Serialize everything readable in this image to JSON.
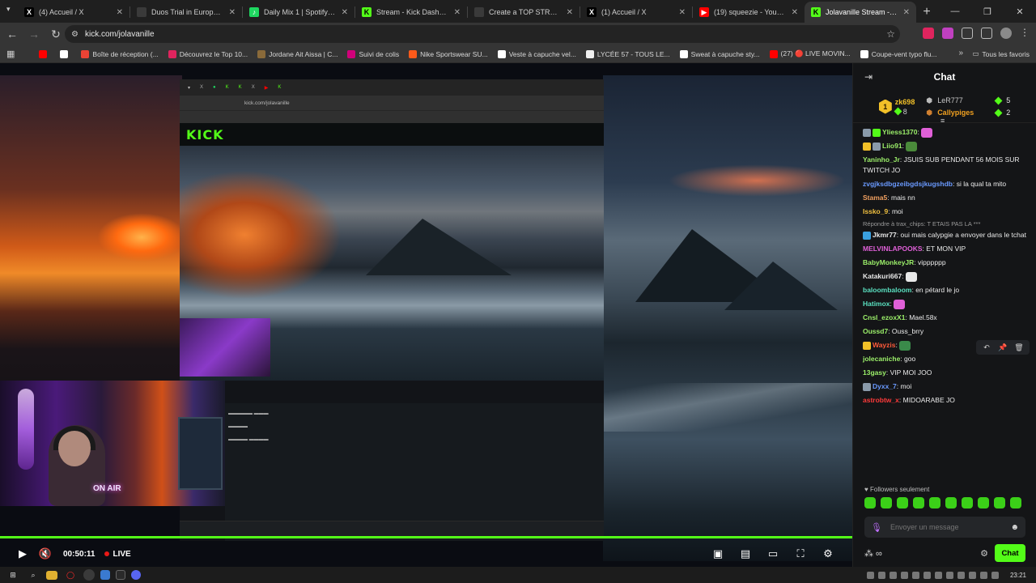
{
  "browser": {
    "tabs": [
      {
        "label": "(4) Accueil / X",
        "icon": "x-logo-icon",
        "icon_text": "X",
        "icon_color": "#000000",
        "active": false
      },
      {
        "label": "Duos Trial in Europe: Sessi",
        "icon": "page-icon",
        "icon_text": "",
        "icon_color": "#3a3a3a",
        "active": false
      },
      {
        "label": "Daily Mix 1 | Spotify Playli",
        "icon": "spotify-icon",
        "icon_text": "♪",
        "icon_color": "#1ed760",
        "active": false
      },
      {
        "label": "Stream - Kick Dashboard",
        "icon": "kick-icon",
        "icon_text": "K",
        "icon_color": "#53fc18",
        "active": false
      },
      {
        "label": "Create a TOP STREAMER",
        "icon": "page-icon",
        "icon_text": "",
        "icon_color": "#3a3a3a",
        "active": false
      },
      {
        "label": "(1) Accueil / X",
        "icon": "x-logo-icon",
        "icon_text": "X",
        "icon_color": "#000000",
        "active": false
      },
      {
        "label": "(19) squeezie - YouTube",
        "icon": "youtube-icon",
        "icon_text": "▶",
        "icon_color": "#ff0000",
        "active": false
      },
      {
        "label": "Jolavanille Stream - Watc",
        "icon": "kick-icon",
        "icon_text": "K",
        "icon_color": "#53fc18",
        "active": true
      }
    ],
    "url": "kick.com/jolavanille",
    "bookmarks": [
      {
        "label": "",
        "color": "#ff0000"
      },
      {
        "label": "",
        "color": "#ffffff"
      },
      {
        "label": "Boîte de réception (...",
        "color": "#ea4335"
      },
      {
        "label": "Découvrez le Top 10...",
        "color": "#e0245e"
      },
      {
        "label": "Jordane Ait Aissa | C...",
        "color": "#8a6a3a"
      },
      {
        "label": "Suivi de colis",
        "color": "#d0007a"
      },
      {
        "label": "Nike Sportswear SU...",
        "color": "#ff5a1a"
      },
      {
        "label": "Veste à capuche vel...",
        "color": "#ffffff"
      },
      {
        "label": "LYCÉE 57 - TOUS LE...",
        "color": "#f0f0f0"
      },
      {
        "label": "Sweat à capuche sty...",
        "color": "#ffffff"
      },
      {
        "label": "(27) 🔴 LIVE MOVIN...",
        "color": "#ff0000"
      },
      {
        "label": "Coupe-vent typo flu...",
        "color": "#ffffff"
      }
    ],
    "all_bookmarks": "Tous les favoris"
  },
  "player": {
    "inner_logo": "KICK",
    "time": "00:50:11",
    "live": "LIVE",
    "on_air": "ON AIR"
  },
  "chat": {
    "title": "Chat",
    "leaderboard": {
      "top": {
        "name": "zk698",
        "rank": "1",
        "points": "8"
      },
      "others": [
        {
          "name": "LeR777",
          "points": "5"
        },
        {
          "name": "Callypiges",
          "points": "2"
        }
      ]
    },
    "messages": [
      {
        "user": "Yliess1370",
        "color": "#9cf06a",
        "text": "",
        "emote": "#e060d8",
        "badges": [
          "#8a9aaa",
          "#53fc18"
        ]
      },
      {
        "user": "Liio91",
        "color": "#9cf06a",
        "text": "",
        "emote": "#4a8a3a",
        "badges": [
          "#f2c028",
          "#8a9aaa"
        ]
      },
      {
        "user": "Yaninho_Jr",
        "color": "#9cf06a",
        "text": "JSUIS SUB PENDANT 56 MOIS SUR TWITCH JO",
        "emote": "",
        "badges": []
      },
      {
        "user": "zvgjksdbgzeibgdsjkugshdb",
        "color": "#6a9aff",
        "text": "si la qual ta mito",
        "emote": "",
        "badges": []
      },
      {
        "user": "Stama5",
        "color": "#f0a060",
        "text": "mais nn",
        "emote": "",
        "badges": []
      },
      {
        "user": "Issko_9",
        "color": "#f0c040",
        "text": "moi",
        "emote": "",
        "badges": []
      },
      {
        "user": "Jkmr77",
        "color": "#e8e8e8",
        "text": "oui mais calypgie a envoyer dans le tchat",
        "emote": "",
        "badges": [
          "#3aa0e0"
        ],
        "reply": "Répondre à trax_chips: T ETAIS PAS LA ***"
      },
      {
        "user": "MELVINLAPOOKS",
        "color": "#e060d8",
        "text": "ET MON VIP",
        "emote": "",
        "badges": []
      },
      {
        "user": "BabyMonkeyJR",
        "color": "#9cf06a",
        "text": "vipppppp",
        "emote": "",
        "badges": []
      },
      {
        "user": "Katakuri667",
        "color": "#e8e8e8",
        "text": "",
        "emote": "#e8e8e8",
        "badges": []
      },
      {
        "user": "baloombaloom",
        "color": "#5ae0c0",
        "text": "en pétard le jo",
        "emote": "",
        "badges": []
      },
      {
        "user": "Hatimox",
        "color": "#5ae0c0",
        "text": "",
        "emote": "#e060d8",
        "badges": []
      },
      {
        "user": "Cnsl_ezoxX1",
        "color": "#9cf06a",
        "text": "Mael.58x",
        "emote": "",
        "badges": []
      },
      {
        "user": "Oussd7",
        "color": "#9cf06a",
        "text": "Ouss_brry",
        "emote": "",
        "badges": []
      },
      {
        "user": "Wayzis",
        "color": "#ff5a3a",
        "text": "",
        "emote": "#3a8a4a",
        "badges": [
          "#f2c028"
        ]
      },
      {
        "user": "jolecaniche",
        "color": "#9cf06a",
        "text": "goo",
        "emote": "",
        "badges": []
      },
      {
        "user": "13gasy",
        "color": "#9cf06a",
        "text": "VIP MOI JOO",
        "emote": "",
        "badges": []
      },
      {
        "user": "Dyxx_7",
        "color": "#6a9aff",
        "text": "moi",
        "emote": "",
        "badges": [
          "#8a9aaa"
        ]
      },
      {
        "user": "astrobtw_x",
        "color": "#ff3a3a",
        "text": "MIDOARABE JO",
        "emote": "",
        "badges": []
      }
    ],
    "followers_only": "Followers seulement",
    "input_placeholder": "Envoyer un message",
    "send_label": "Chat"
  },
  "taskbar": {
    "clock": "23:21"
  },
  "colors": {
    "kick_green": "#53fc18",
    "background": "#0e0e10"
  }
}
